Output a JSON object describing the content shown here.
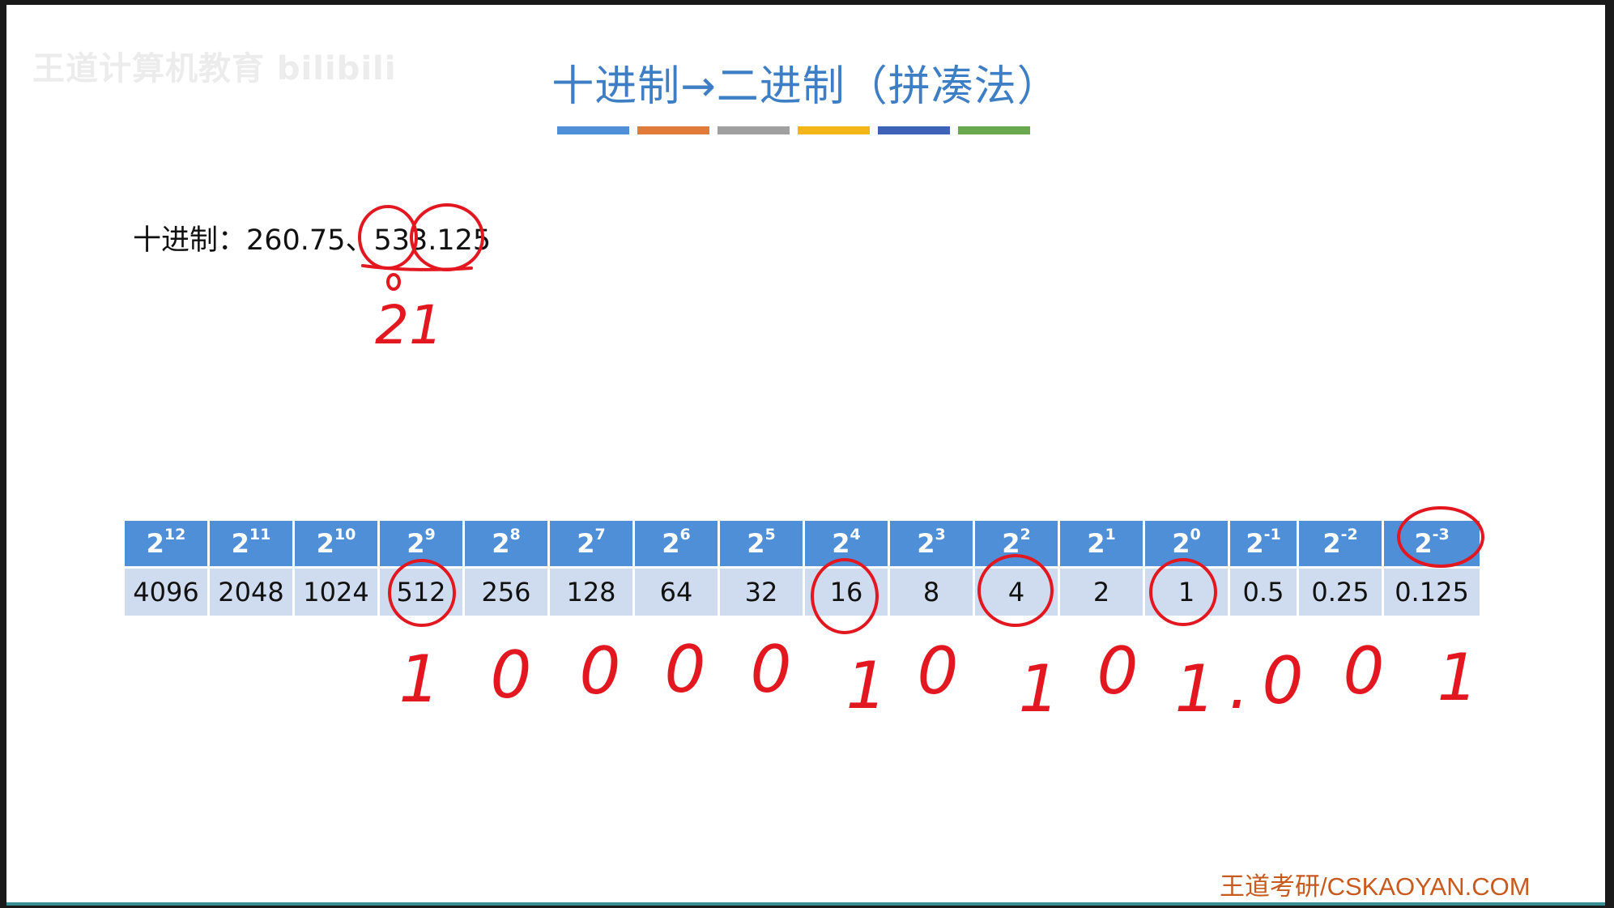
{
  "watermark": "王道计算机教育 bilibili",
  "title": "十进制→二进制（拼凑法）",
  "title_bar_colors": [
    "#4f8fd8",
    "#e07b39",
    "#a0a0a0",
    "#f2b618",
    "#3e62b5",
    "#6aa84f"
  ],
  "decimal_line": "十进制：260.75、533.125",
  "table": {
    "powers": [
      {
        "base": "2",
        "exp": "12"
      },
      {
        "base": "2",
        "exp": "11"
      },
      {
        "base": "2",
        "exp": "10"
      },
      {
        "base": "2",
        "exp": "9"
      },
      {
        "base": "2",
        "exp": "8"
      },
      {
        "base": "2",
        "exp": "7"
      },
      {
        "base": "2",
        "exp": "6"
      },
      {
        "base": "2",
        "exp": "5"
      },
      {
        "base": "2",
        "exp": "4"
      },
      {
        "base": "2",
        "exp": "3"
      },
      {
        "base": "2",
        "exp": "2"
      },
      {
        "base": "2",
        "exp": "1"
      },
      {
        "base": "2",
        "exp": "0"
      },
      {
        "base": "2",
        "exp": "-1"
      },
      {
        "base": "2",
        "exp": "-2"
      },
      {
        "base": "2",
        "exp": "-3"
      }
    ],
    "values": [
      "4096",
      "2048",
      "1024",
      "512",
      "256",
      "128",
      "64",
      "32",
      "16",
      "8",
      "4",
      "2",
      "1",
      "0.5",
      "0.25",
      "0.125"
    ]
  },
  "annotations": {
    "ink_color": "#e3171f",
    "remainder_note": "21",
    "binary_digits": [
      "1",
      "0",
      "0",
      "0",
      "0",
      "1",
      "0",
      "1",
      "0",
      "1",
      ".",
      "0",
      "0",
      "1"
    ]
  },
  "footer": "王道考研/CSKAOYAN.COM"
}
